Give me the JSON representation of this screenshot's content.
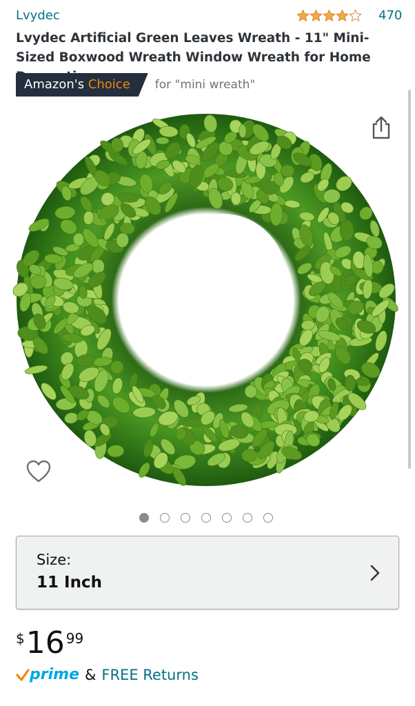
{
  "product": {
    "brand": "Lvydec",
    "title": "Lvydec Artificial Green Leaves Wreath - 11\" Mini-Sized Boxwood Wreath Window Wreath for Home Decoration",
    "rating": {
      "stars": 4,
      "max_stars": 5,
      "count": "470"
    },
    "badge": {
      "prefix": "Amazon's",
      "highlight": "Choice",
      "for_text": "for \"mini wreath\""
    },
    "gallery": {
      "image_count": 7,
      "active_index": 0
    },
    "size": {
      "label": "Size:",
      "value": "11 Inch"
    },
    "price": {
      "symbol": "$",
      "whole": "16",
      "fraction": "99"
    },
    "prime": {
      "logo_text": "prime",
      "amp": "&",
      "free_returns": "FREE Returns"
    }
  },
  "icons": {
    "share": "share-icon",
    "favorite": "heart-icon",
    "chevron": "chevron-right-icon",
    "prime_check": "prime-check-icon"
  },
  "colors": {
    "link": "#007185",
    "star": "#f3a847",
    "badge_bg": "#232f3e",
    "badge_choice": "#f08804",
    "prime": "#00a8e1"
  }
}
